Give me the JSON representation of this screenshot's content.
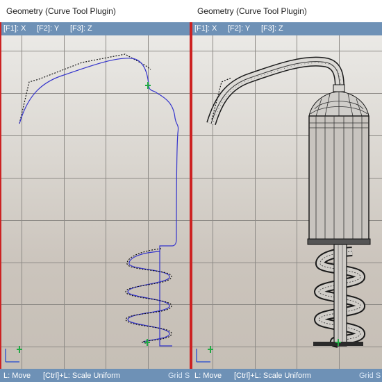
{
  "left_panel": {
    "title": "Geometry (Curve Tool Plugin)",
    "keys": {
      "f1": "[F1]: X",
      "f2": "[F2]: Y",
      "f3": "[F3]: Z"
    },
    "status": {
      "move": "L: Move",
      "scale": "[Ctrl]+L: Scale Uniform",
      "grid": "Grid S"
    }
  },
  "right_panel": {
    "title": "Geometry (Curve Tool Plugin)",
    "keys": {
      "f1": "[F1]: X",
      "f2": "[F2]: Y",
      "f3": "[F3]: Z"
    },
    "status": {
      "move": "L: Move",
      "scale": "[Ctrl]+L: Scale Uniform",
      "grid": "Grid S"
    }
  },
  "colors": {
    "curve": "#3333cc",
    "control_polygon": "#111111",
    "handle": "#22aa44",
    "viewport_border": "#cc2222",
    "status_bar": "#6e91b6"
  },
  "icons": {
    "axis_gizmo": "axis-gizmo-icon"
  }
}
